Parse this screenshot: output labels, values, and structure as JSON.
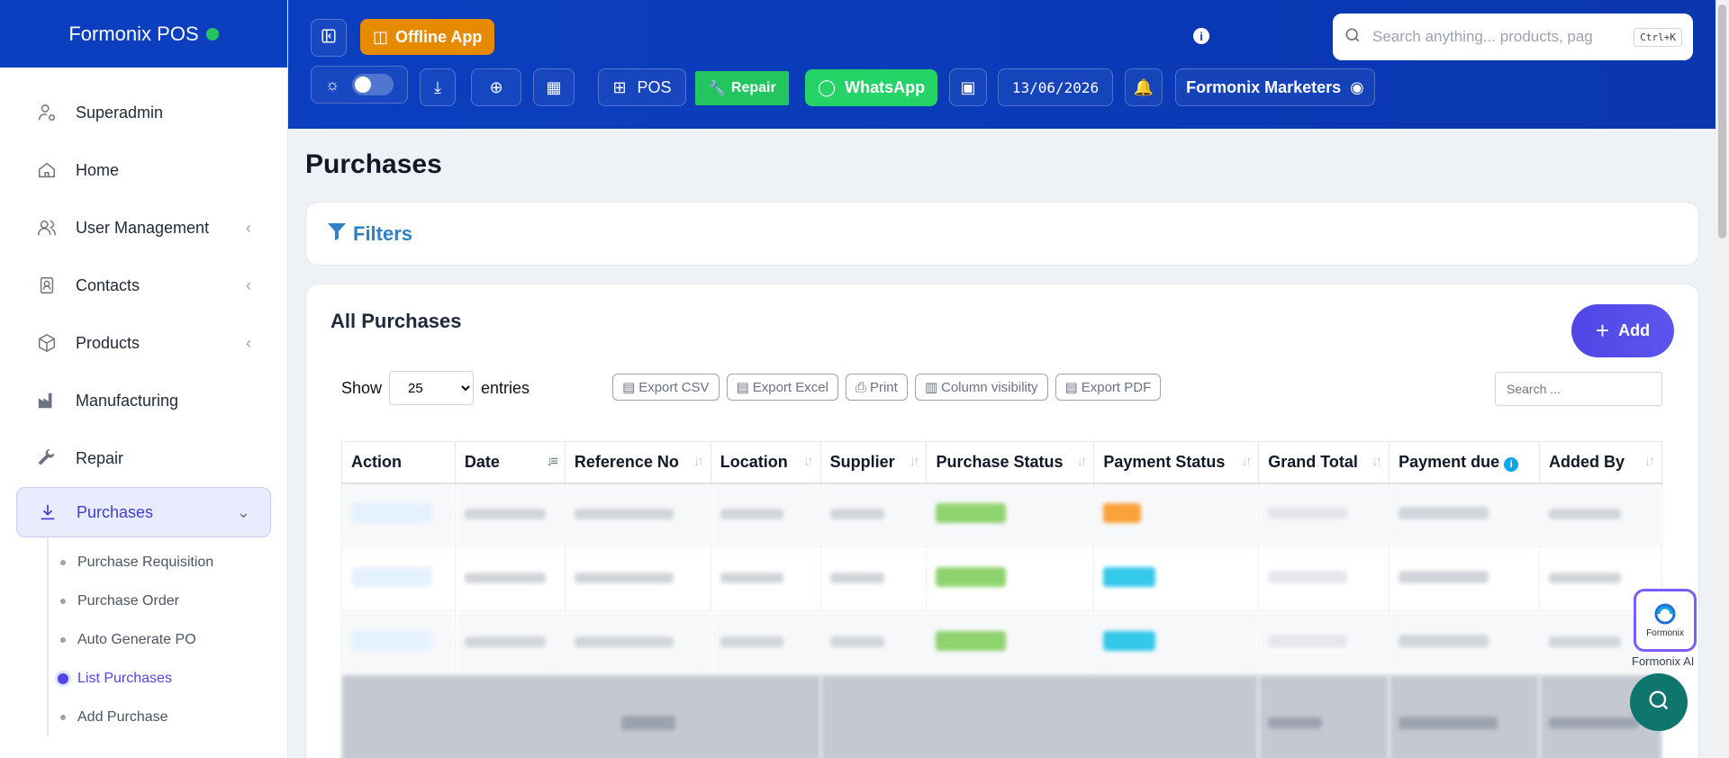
{
  "brand": {
    "name": "Formonix POS"
  },
  "sidebar": {
    "items": [
      {
        "label": "Superadmin"
      },
      {
        "label": "Home"
      },
      {
        "label": "User Management"
      },
      {
        "label": "Contacts"
      },
      {
        "label": "Products"
      },
      {
        "label": "Manufacturing"
      },
      {
        "label": "Repair"
      },
      {
        "label": "Purchases"
      }
    ],
    "sub_items": [
      {
        "label": "Purchase Requisition"
      },
      {
        "label": "Purchase Order"
      },
      {
        "label": "Auto Generate PO"
      },
      {
        "label": "List Purchases"
      },
      {
        "label": "Add Purchase"
      }
    ]
  },
  "header": {
    "offline_label": "Offline App",
    "pos_label": "POS",
    "repair_label": "Repair",
    "whatsapp_label": "WhatsApp",
    "date": "13/06/2026",
    "business": "Formonix Marketers",
    "search_placeholder": "Search anything... products, pag",
    "shortcut": "Ctrl+K"
  },
  "page": {
    "title": "Purchases",
    "filters_label": "Filters"
  },
  "purchases": {
    "title": "All Purchases",
    "add_label": "Add",
    "show_label": "Show",
    "entries_label": "entries",
    "page_size": "25",
    "export_buttons": [
      "Export CSV",
      "Export Excel",
      "Print",
      "Column visibility",
      "Export PDF"
    ],
    "search_placeholder": "Search ...",
    "columns": [
      "Action",
      "Date",
      "Reference No",
      "Location",
      "Supplier",
      "Purchase Status",
      "Payment Status",
      "Grand Total",
      "Payment due",
      "Added By"
    ]
  },
  "ai": {
    "logo": "Formonix",
    "label": "Formonix AI"
  },
  "colors": {
    "header": "#0b3fbf",
    "accent": "#4f46e5",
    "offline": "#e68a00",
    "whatsapp": "#25d366",
    "repair": "#22c55e"
  }
}
